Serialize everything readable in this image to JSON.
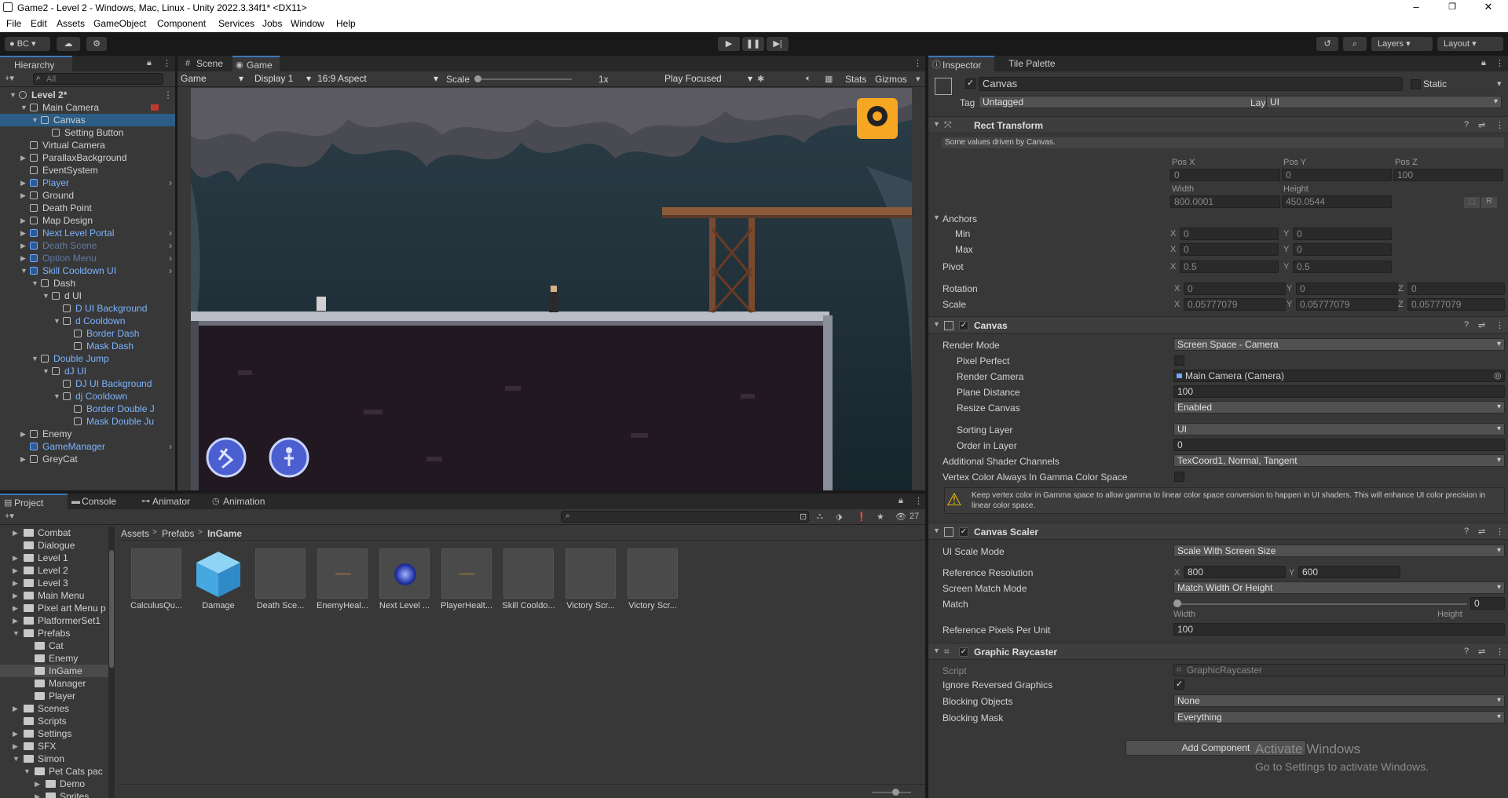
{
  "window": {
    "title": "Game2 - Level 2 - Windows, Mac, Linux - Unity 2022.3.34f1* <DX11>"
  },
  "menu": [
    "File",
    "Edit",
    "Assets",
    "GameObject",
    "Component",
    "Services",
    "Jobs",
    "Window",
    "Help"
  ],
  "toolbar": {
    "account": "BC",
    "layers": "Layers",
    "layout": "Layout"
  },
  "hierarchy": {
    "tab": "Hierarchy",
    "search_placeholder": "All",
    "items": [
      {
        "label": "Level 2*",
        "depth": 0,
        "kind": "scene",
        "fold": "open"
      },
      {
        "label": "Main Camera",
        "depth": 1,
        "kind": "obj",
        "fold": "open"
      },
      {
        "label": "Canvas",
        "depth": 2,
        "kind": "obj",
        "fold": "open",
        "selected": true
      },
      {
        "label": "Setting Button",
        "depth": 3,
        "kind": "obj",
        "fold": "none"
      },
      {
        "label": "Virtual Camera",
        "depth": 1,
        "kind": "obj",
        "fold": "none"
      },
      {
        "label": "ParallaxBackground",
        "depth": 1,
        "kind": "obj",
        "fold": "closed"
      },
      {
        "label": "EventSystem",
        "depth": 1,
        "kind": "obj",
        "fold": "none"
      },
      {
        "label": "Player",
        "depth": 1,
        "kind": "prefab",
        "fold": "closed",
        "arrow": true
      },
      {
        "label": "Ground",
        "depth": 1,
        "kind": "obj",
        "fold": "closed"
      },
      {
        "label": "Death Point",
        "depth": 1,
        "kind": "obj",
        "fold": "none"
      },
      {
        "label": "Map Design",
        "depth": 1,
        "kind": "obj",
        "fold": "closed"
      },
      {
        "label": "Next Level Portal",
        "depth": 1,
        "kind": "prefab",
        "fold": "closed",
        "arrow": true
      },
      {
        "label": "Death Scene",
        "depth": 1,
        "kind": "prefab-dim",
        "fold": "closed",
        "arrow": true
      },
      {
        "label": "Option Menu",
        "depth": 1,
        "kind": "prefab-dim",
        "fold": "closed",
        "arrow": true
      },
      {
        "label": "Skill Cooldown UI",
        "depth": 1,
        "kind": "prefab",
        "fold": "open",
        "arrow": true
      },
      {
        "label": "Dash",
        "depth": 2,
        "kind": "obj",
        "fold": "open"
      },
      {
        "label": "d UI",
        "depth": 3,
        "kind": "obj",
        "fold": "open"
      },
      {
        "label": "D UI Background",
        "depth": 4,
        "kind": "objblue",
        "fold": "none"
      },
      {
        "label": "d Cooldown",
        "depth": 4,
        "kind": "objblue",
        "fold": "open"
      },
      {
        "label": "Border Dash",
        "depth": 5,
        "kind": "objblue",
        "fold": "none"
      },
      {
        "label": "Mask Dash",
        "depth": 5,
        "kind": "objblue",
        "fold": "none"
      },
      {
        "label": "Double Jump",
        "depth": 2,
        "kind": "objblue",
        "fold": "open"
      },
      {
        "label": "dJ UI",
        "depth": 3,
        "kind": "objblue",
        "fold": "open"
      },
      {
        "label": "DJ UI Background",
        "depth": 4,
        "kind": "objblue",
        "fold": "none"
      },
      {
        "label": "dj Cooldown",
        "depth": 4,
        "kind": "objblue",
        "fold": "open"
      },
      {
        "label": "Border Double J",
        "depth": 5,
        "kind": "objblue",
        "fold": "none"
      },
      {
        "label": "Mask Double Ju",
        "depth": 5,
        "kind": "objblue",
        "fold": "none"
      },
      {
        "label": "Enemy",
        "depth": 1,
        "kind": "obj",
        "fold": "closed"
      },
      {
        "label": "GameManager",
        "depth": 1,
        "kind": "prefab",
        "fold": "none",
        "arrow": true
      },
      {
        "label": "GreyCat",
        "depth": 1,
        "kind": "obj",
        "fold": "closed"
      }
    ]
  },
  "game": {
    "tabs": [
      "Scene",
      "Game"
    ],
    "mode": "Game",
    "display": "Display 1",
    "aspect": "16:9 Aspect",
    "scale_label": "Scale",
    "scale_value": "1x",
    "play_mode": "Play Focused",
    "stats": "Stats",
    "gizmos": "Gizmos"
  },
  "inspector": {
    "tabs": [
      "Inspector",
      "Tile Palette"
    ],
    "object_name": "Canvas",
    "static_label": "Static",
    "tag_label": "Tag",
    "tag_value": "Untagged",
    "layer_label": "Layer",
    "layer_value": "UI",
    "rect": {
      "title": "Rect Transform",
      "note": "Some values driven by Canvas.",
      "posx_label": "Pos X",
      "posx": "0",
      "posy_label": "Pos Y",
      "posy": "0",
      "posz_label": "Pos Z",
      "posz": "100",
      "width_label": "Width",
      "width": "800.0001",
      "height_label": "Height",
      "height": "450.0544",
      "anchors": "Anchors",
      "min": "Min",
      "min_x": "0",
      "min_y": "0",
      "max": "Max",
      "max_x": "0",
      "max_y": "0",
      "pivot": "Pivot",
      "pivot_x": "0.5",
      "pivot_y": "0.5",
      "rotation": "Rotation",
      "rot_x": "0",
      "rot_y": "0",
      "rot_z": "0",
      "scale": "Scale",
      "scale_x": "0.05777079",
      "scale_y": "0.05777079",
      "scale_z": "0.05777079",
      "r_btn": "R"
    },
    "canvas": {
      "title": "Canvas",
      "render_mode_label": "Render Mode",
      "render_mode": "Screen Space - Camera",
      "pixel_perfect": "Pixel Perfect",
      "render_camera_label": "Render Camera",
      "render_camera": "Main Camera (Camera)",
      "plane_distance_label": "Plane Distance",
      "plane_distance": "100",
      "resize_canvas_label": "Resize Canvas",
      "resize_canvas": "Enabled",
      "sorting_layer_label": "Sorting Layer",
      "sorting_layer": "UI",
      "order_label": "Order in Layer",
      "order": "0",
      "shader_label": "Additional Shader Channels",
      "shader": "TexCoord1, Normal, Tangent",
      "gamma_label": "Vertex Color Always In Gamma Color Space",
      "warning": "Keep vertex color in Gamma space to allow gamma to linear color space conversion to happen in UI shaders. This will enhance UI color precision in linear color space."
    },
    "scaler": {
      "title": "Canvas Scaler",
      "ui_scale_label": "UI Scale Mode",
      "ui_scale": "Scale With Screen Size",
      "ref_res_label": "Reference Resolution",
      "ref_x": "800",
      "ref_y": "600",
      "match_mode_label": "Screen Match Mode",
      "match_mode": "Match Width Or Height",
      "match_label": "Match",
      "match_value": "0",
      "width_word": "Width",
      "height_word": "Height",
      "ppu_label": "Reference Pixels Per Unit",
      "ppu": "100"
    },
    "raycaster": {
      "title": "Graphic Raycaster",
      "script_label": "Script",
      "script": "GraphicRaycaster",
      "ignore_label": "Ignore Reversed Graphics",
      "blocking_label": "Blocking Objects",
      "blocking": "None",
      "mask_label": "Blocking Mask",
      "mask": "Everything"
    },
    "add_component": "Add Component"
  },
  "project": {
    "tabs": [
      "Project",
      "Console",
      "Animator",
      "Animation"
    ],
    "count": "27",
    "breadcrumb": [
      "Assets",
      "Prefabs",
      "InGame"
    ],
    "tree": [
      {
        "label": "Combat",
        "depth": 1,
        "fold": "closed"
      },
      {
        "label": "Dialogue",
        "depth": 1,
        "fold": "none"
      },
      {
        "label": "Level 1",
        "depth": 1,
        "fold": "closed"
      },
      {
        "label": "Level 2",
        "depth": 1,
        "fold": "closed"
      },
      {
        "label": "Level 3",
        "depth": 1,
        "fold": "closed"
      },
      {
        "label": "Main Menu",
        "depth": 1,
        "fold": "closed"
      },
      {
        "label": "Pixel art Menu p",
        "depth": 1,
        "fold": "closed"
      },
      {
        "label": "PlatformerSet1",
        "depth": 1,
        "fold": "closed"
      },
      {
        "label": "Prefabs",
        "depth": 1,
        "fold": "open"
      },
      {
        "label": "Cat",
        "depth": 2,
        "fold": "none"
      },
      {
        "label": "Enemy",
        "depth": 2,
        "fold": "none"
      },
      {
        "label": "InGame",
        "depth": 2,
        "fold": "none",
        "selected": true
      },
      {
        "label": "Manager",
        "depth": 2,
        "fold": "none"
      },
      {
        "label": "Player",
        "depth": 2,
        "fold": "none"
      },
      {
        "label": "Scenes",
        "depth": 1,
        "fold": "closed"
      },
      {
        "label": "Scripts",
        "depth": 1,
        "fold": "none"
      },
      {
        "label": "Settings",
        "depth": 1,
        "fold": "closed"
      },
      {
        "label": "SFX",
        "depth": 1,
        "fold": "closed"
      },
      {
        "label": "Simon",
        "depth": 1,
        "fold": "open"
      },
      {
        "label": "Pet Cats pac",
        "depth": 2,
        "fold": "open"
      },
      {
        "label": "Demo",
        "depth": 3,
        "fold": "closed"
      },
      {
        "label": "Sprites",
        "depth": 3,
        "fold": "closed"
      }
    ],
    "assets": [
      {
        "name": "CalculusQu...",
        "thumb": "grey"
      },
      {
        "name": "Damage",
        "thumb": "cube"
      },
      {
        "name": "Death Sce...",
        "thumb": "grey"
      },
      {
        "name": "EnemyHeal...",
        "thumb": "line"
      },
      {
        "name": "Next Level ...",
        "thumb": "orb"
      },
      {
        "name": "PlayerHealt...",
        "thumb": "line"
      },
      {
        "name": "Skill Cooldo...",
        "thumb": "grey"
      },
      {
        "name": "Victory Scr...",
        "thumb": "grey"
      },
      {
        "name": "Victory Scr...",
        "thumb": "grey"
      }
    ]
  },
  "watermark": {
    "line1": "Activate Windows",
    "line2": "Go to Settings to activate Windows."
  },
  "colors": {
    "accent": "#3a79bb",
    "selection": "#2c5d87",
    "prefab": "#7cb4ff"
  }
}
